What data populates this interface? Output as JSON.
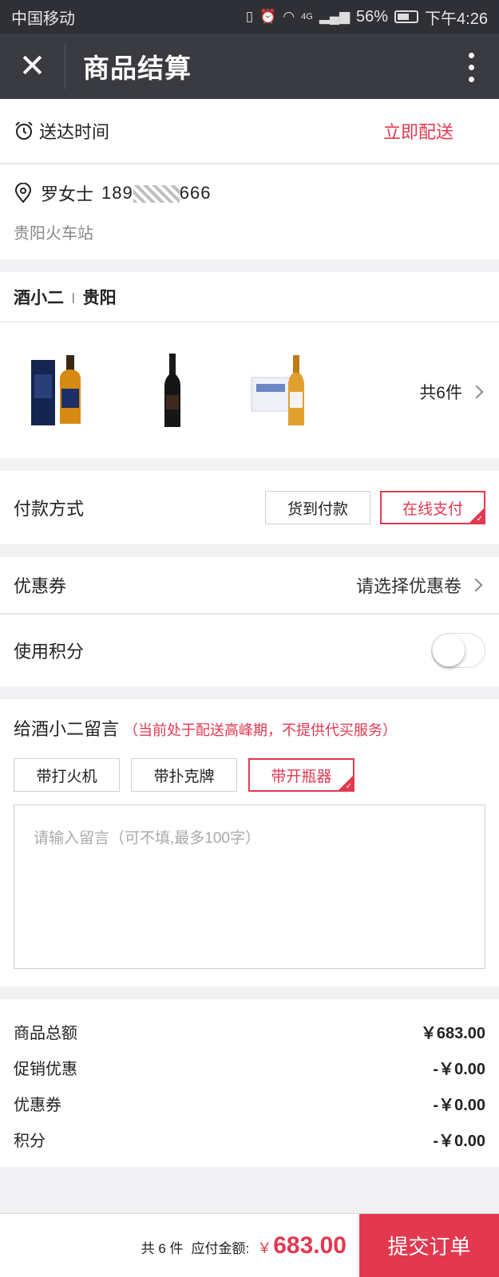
{
  "status_bar": {
    "carrier": "中国移动",
    "battery": "56%",
    "time": "下午4:26",
    "network": "4G"
  },
  "header": {
    "title": "商品结算"
  },
  "delivery": {
    "label": "送达时间",
    "value": "立即配送"
  },
  "address": {
    "name": "罗女士",
    "phone_prefix": "189",
    "phone_suffix": "666",
    "location": "贵阳火车站"
  },
  "shop": {
    "name": "酒小二",
    "city": "贵阳"
  },
  "products": {
    "count_label": "共6件",
    "items": [
      "whisky-box",
      "red-wine-bottle",
      "beer-bottle-box"
    ]
  },
  "payment": {
    "label": "付款方式",
    "options": [
      "货到付款",
      "在线支付"
    ],
    "selected": "在线支付"
  },
  "coupon": {
    "label": "优惠券",
    "value": "请选择优惠卷"
  },
  "points": {
    "label": "使用积分",
    "enabled": false
  },
  "message": {
    "title": "给酒小二留言",
    "hint": "（当前处于配送高峰期，不提供代买服务）",
    "chips": [
      "带打火机",
      "带扑克牌",
      "带开瓶器"
    ],
    "selected_chip": "带开瓶器",
    "placeholder": "请输入留言（可不填,最多100字）"
  },
  "totals": [
    {
      "label": "商品总额",
      "value": "￥683.00"
    },
    {
      "label": "促销优惠",
      "value": "-￥0.00"
    },
    {
      "label": "优惠券",
      "value": "-￥0.00"
    },
    {
      "label": "积分",
      "value": "-￥0.00"
    }
  ],
  "footer": {
    "count_label": "共 6 件",
    "amount_label": "应付金额:",
    "currency": "￥",
    "amount": "683.00",
    "submit_label": "提交订单"
  },
  "colors": {
    "accent": "#e23850",
    "topbar": "#3a3b40",
    "statusbar": "#2f3035"
  }
}
